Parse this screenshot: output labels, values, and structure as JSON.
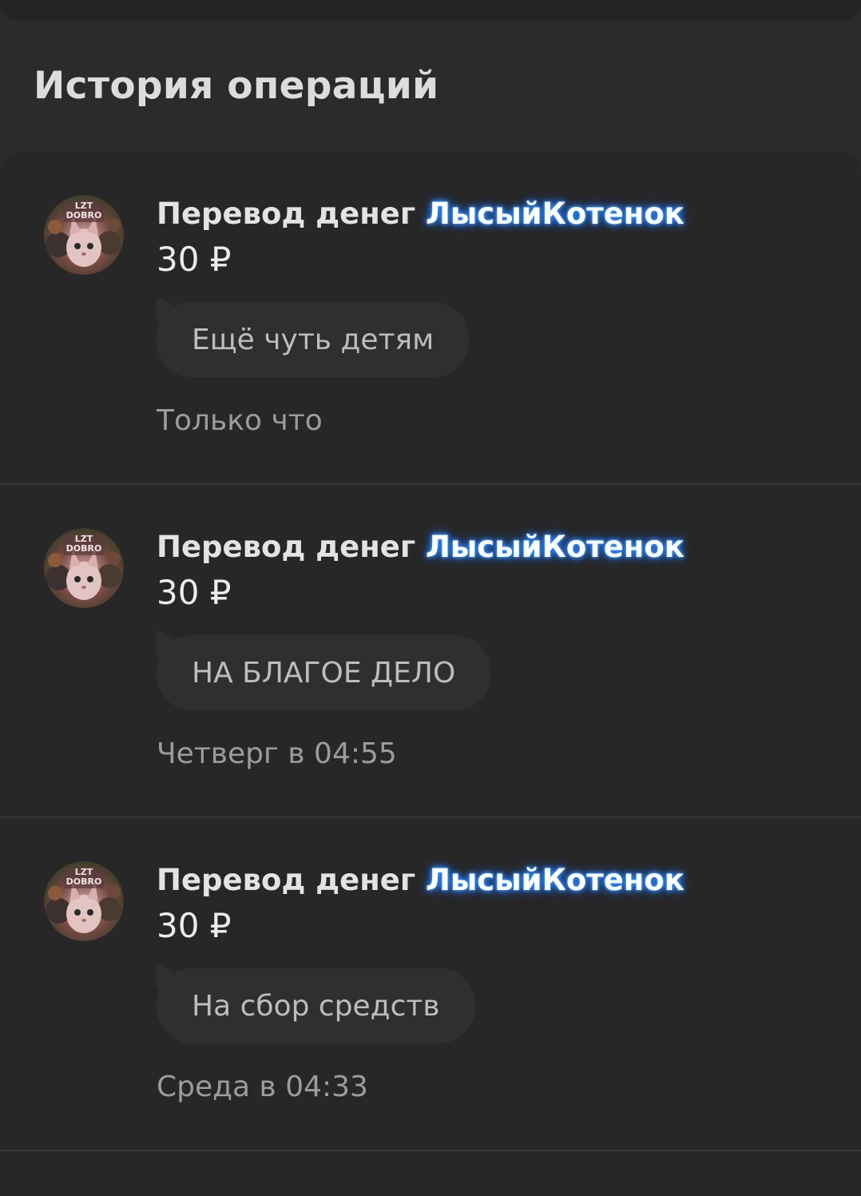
{
  "history": {
    "title": "История операций",
    "items": [
      {
        "title_prefix": "Перевод денег",
        "username": "ЛысыйКотенок",
        "amount": "30 ₽",
        "comment": "Ещё чуть детям",
        "time": "Только что",
        "avatar_text": "LZT DOBRO"
      },
      {
        "title_prefix": "Перевод денег",
        "username": "ЛысыйКотенок",
        "amount": "30 ₽",
        "comment": "НА БЛАГОЕ ДЕЛО",
        "time": "Четверг в 04:55",
        "avatar_text": "LZT DOBRO"
      },
      {
        "title_prefix": "Перевод денег",
        "username": "ЛысыйКотенок",
        "amount": "30 ₽",
        "comment": "На сбор средств",
        "time": "Среда в 04:33",
        "avatar_text": "LZT DOBRO"
      }
    ]
  },
  "colors": {
    "background": "#2b2b2b",
    "card": "#272727",
    "username_glow": "#2f8bff"
  }
}
